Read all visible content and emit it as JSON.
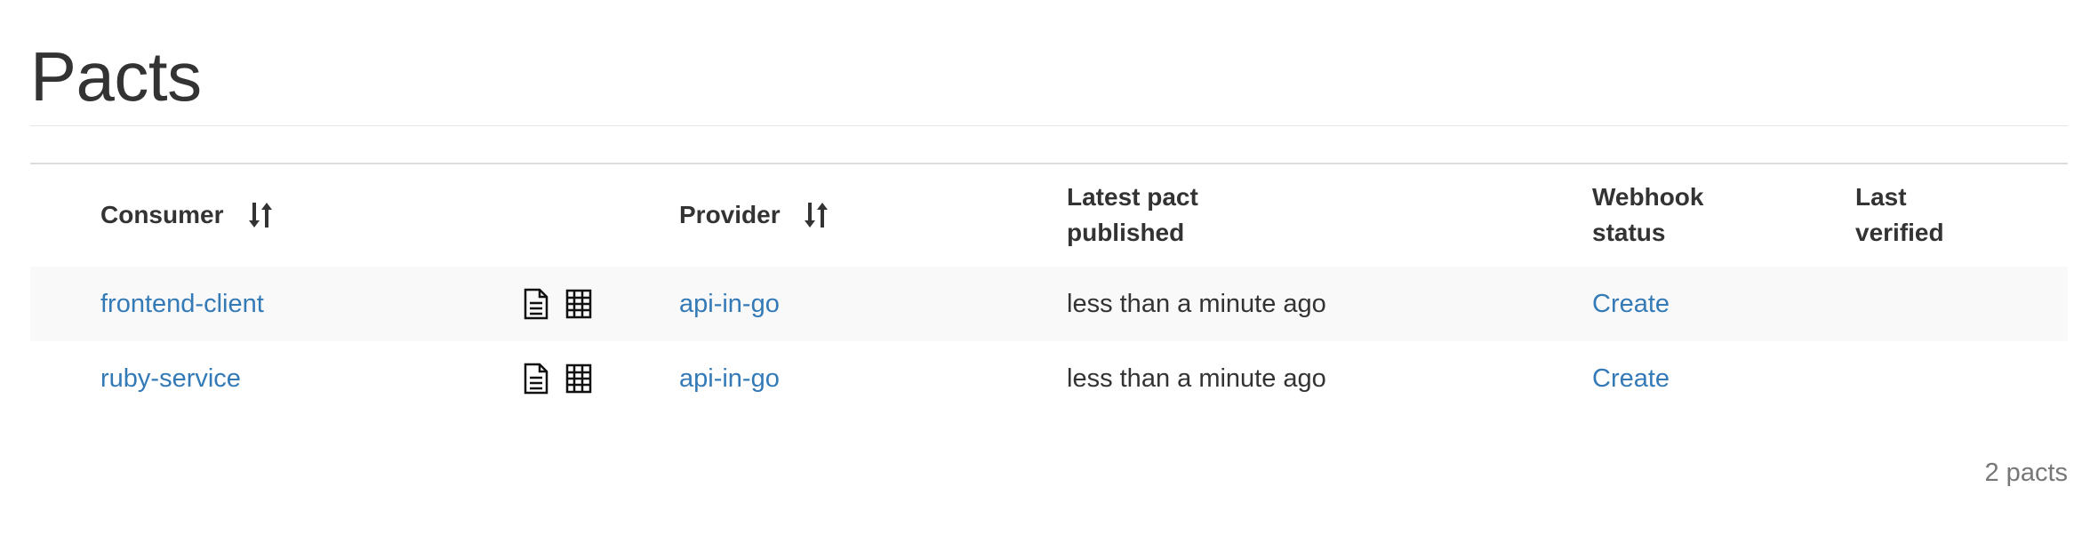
{
  "page": {
    "title": "Pacts"
  },
  "table": {
    "headers": {
      "consumer": "Consumer",
      "provider": "Provider",
      "latest_pact_line1": "Latest pact",
      "latest_pact_line2": "published",
      "webhook_line1": "Webhook",
      "webhook_line2": "status",
      "last_verified_line1": "Last",
      "last_verified_line2": "verified"
    },
    "icons": {
      "sort": "sort-arrows-icon",
      "document": "document-icon",
      "matrix": "grid-matrix-icon"
    },
    "rows": [
      {
        "consumer": "frontend-client",
        "provider": "api-in-go",
        "latest_pact_published": "less than a minute ago",
        "webhook_status": "Create",
        "last_verified": ""
      },
      {
        "consumer": "ruby-service",
        "provider": "api-in-go",
        "latest_pact_published": "less than a minute ago",
        "webhook_status": "Create",
        "last_verified": ""
      }
    ]
  },
  "footer": {
    "count_text": "2 pacts"
  },
  "colors": {
    "link": "#337ab7",
    "text": "#333333",
    "muted": "#777777",
    "stripe": "#f9f9f9"
  }
}
